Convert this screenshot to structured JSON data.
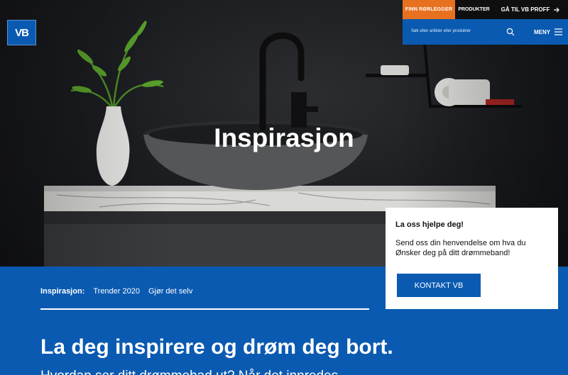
{
  "header": {
    "logo_text": "VB",
    "top_buttons": {
      "find_plumber": "FINN RØRLEGGER",
      "products": "PRODUKTER",
      "proff": "GÅ TIL VB PROFF"
    },
    "search": {
      "placeholder": "Søk etter artikler eller produkter"
    },
    "menu_label": "MENY"
  },
  "hero": {
    "title": "Inspirasjon"
  },
  "help_card": {
    "title": "La oss hjelpe deg!",
    "text": "Send oss din henvendelse om hva du Ønsker deg på ditt drømmeband!",
    "button": "KONTAKT VB"
  },
  "subnav": {
    "label": "Inspirasjon:",
    "items": [
      "Trender 2020",
      "Gjør det selv"
    ]
  },
  "main": {
    "headline": "La deg inspirere og drøm deg bort.",
    "intro": "Hvordan ser ditt drømmebad ut? Når det innredes"
  },
  "colors": {
    "brand_blue": "#0a5ab1",
    "accent_orange": "#e8711f",
    "topbar_dark": "#0f0f10"
  },
  "icons": [
    "search-icon",
    "hamburger-menu-icon",
    "arrow-right-icon"
  ]
}
